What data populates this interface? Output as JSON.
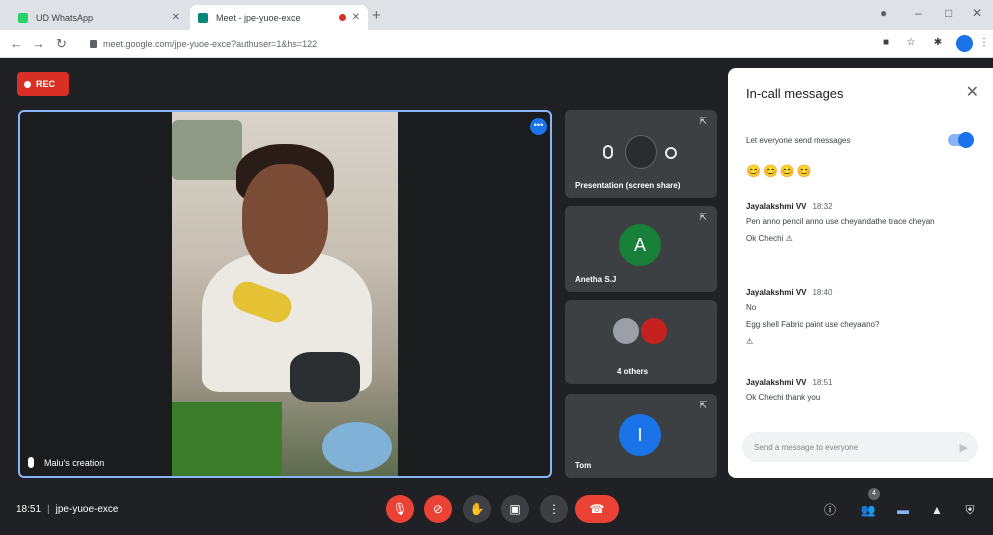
{
  "browser": {
    "tabs": [
      {
        "title": "UD WhatsApp",
        "favicon_color": "#25d366"
      },
      {
        "title": "Meet - jpe-yuoe-exce",
        "favicon_color": "#00897b"
      }
    ],
    "url": "meet.google.com/jpe-yuoe-exce?authuser=1&hs=122"
  },
  "meeting": {
    "recording_label": "REC",
    "main_participant": "Malu's creation",
    "more_badge": "•••",
    "time": "18:51",
    "meeting_code": "jpe-yuoe-exce",
    "participant_count": "4"
  },
  "tiles": [
    {
      "name": "Presentation (screen share)",
      "initial": ""
    },
    {
      "name": "Anetha S.J",
      "initial": "A",
      "color": "#188038"
    },
    {
      "name": "4 others",
      "initial": ""
    },
    {
      "name": "Tom",
      "initial": "I",
      "color": "#1a73e8"
    }
  ],
  "chat": {
    "title": "In-call messages",
    "permission_label": "Let everyone send messages",
    "emoji_row": "😊😊😊😊",
    "messages": [
      {
        "sender": "Jayalakshmi VV",
        "time": "18:32",
        "lines": [
          "Pen anno pencil anno use cheyandathe trace cheyan",
          "Ok Chechi ⚠"
        ]
      },
      {
        "sender": "Jayalakshmi VV",
        "time": "18:40",
        "lines": [
          "No",
          "Egg shell Fabric paint use cheyaano?",
          "⚠"
        ]
      },
      {
        "sender": "Jayalakshmi VV",
        "time": "18:51",
        "lines": [
          "Ok Chechi thank you"
        ]
      }
    ],
    "input_placeholder": "Send a message to everyone"
  },
  "colors": {
    "meet_bg": "#202124",
    "tile_bg": "#3c4043",
    "accent": "#1a73e8",
    "hangup": "#ea4335"
  }
}
